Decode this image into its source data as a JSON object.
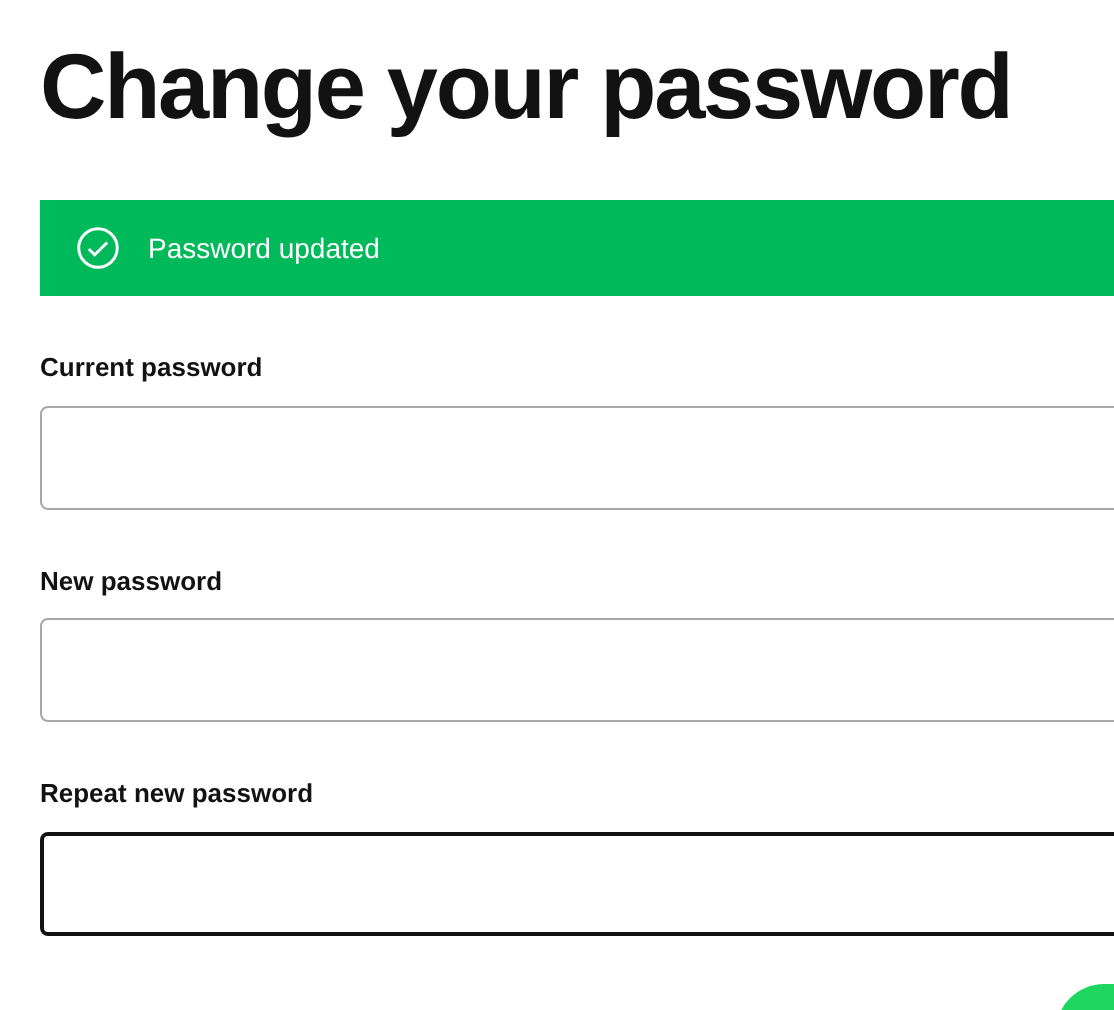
{
  "title": "Change your password",
  "alert": {
    "kind": "success",
    "message": "Password updated"
  },
  "fields": [
    {
      "label": "Current password",
      "focused": false
    },
    {
      "label": "New password",
      "focused": false
    },
    {
      "label": "Repeat new password",
      "focused": true
    }
  ]
}
